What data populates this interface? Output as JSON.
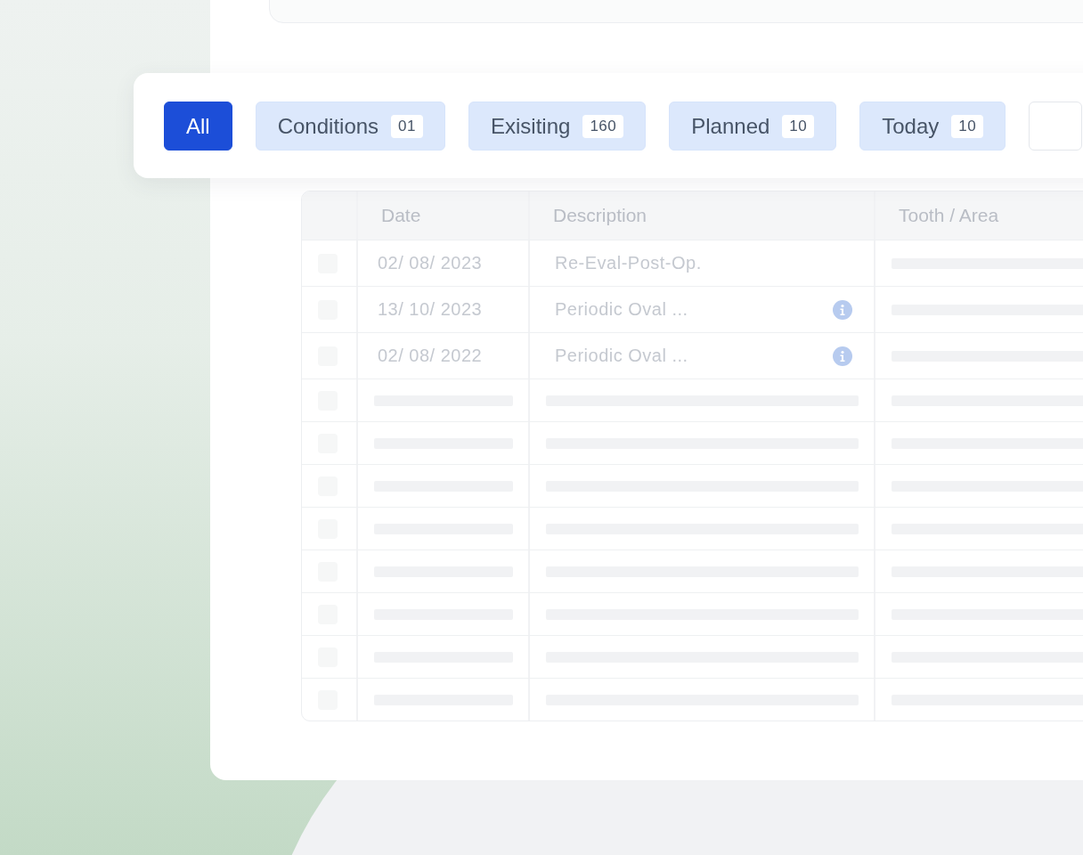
{
  "filters": [
    {
      "kind": "chip",
      "label": "All",
      "selected": true
    },
    {
      "kind": "chip",
      "label": "Conditions",
      "count": "01",
      "selected": false
    },
    {
      "kind": "chip",
      "label": "Exisiting",
      "count": "160",
      "selected": false
    },
    {
      "kind": "chip",
      "label": "Planned",
      "count": "10",
      "selected": false
    },
    {
      "kind": "chip",
      "label": "Today",
      "count": "10",
      "selected": false
    },
    {
      "kind": "cut",
      "selected": false
    }
  ],
  "table": {
    "columns": [
      "Date",
      "Description",
      "Tooth / Area"
    ],
    "rows": [
      {
        "kind": "data",
        "checked": false,
        "date": "02/ 08/ 2023",
        "description": "Re-Eval-Post-Op.",
        "info": false
      },
      {
        "kind": "data",
        "checked": false,
        "date": "13/ 10/ 2023",
        "description": "Periodic Oval ...",
        "info": true
      },
      {
        "kind": "data",
        "checked": false,
        "date": "02/ 08/ 2022",
        "description": "Periodic Oval ...",
        "info": true
      },
      {
        "kind": "skeleton",
        "checked": false
      },
      {
        "kind": "skeleton",
        "checked": false
      },
      {
        "kind": "skeleton",
        "checked": false
      },
      {
        "kind": "skeleton",
        "checked": false
      },
      {
        "kind": "skeleton",
        "checked": false
      },
      {
        "kind": "skeleton",
        "checked": false
      },
      {
        "kind": "skeleton",
        "checked": false
      },
      {
        "kind": "skeleton",
        "checked": false
      }
    ]
  }
}
